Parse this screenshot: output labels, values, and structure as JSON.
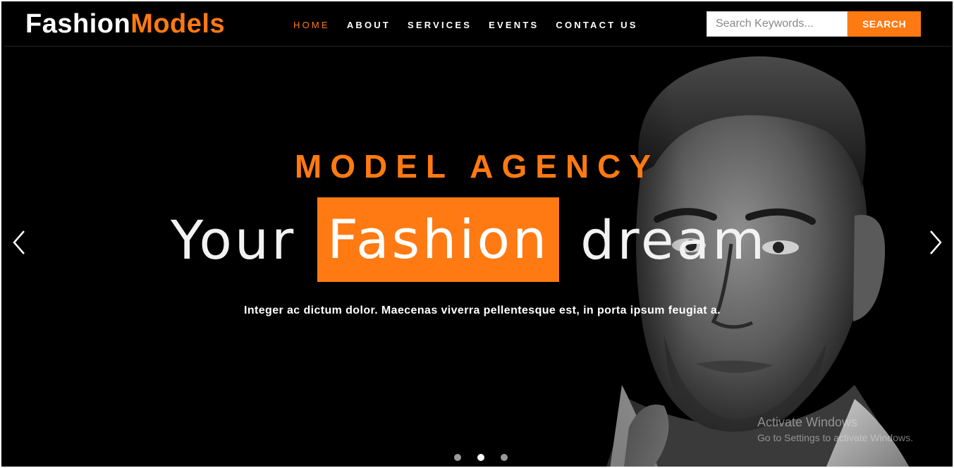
{
  "brand": {
    "part1": "Fashion",
    "part2": "Models"
  },
  "nav": {
    "items": [
      {
        "label": "HOME"
      },
      {
        "label": "ABOUT"
      },
      {
        "label": "SERVICES"
      },
      {
        "label": "EVENTS"
      },
      {
        "label": "CONTACT US"
      }
    ],
    "active_index": 0
  },
  "search": {
    "placeholder": "Search Keywords...",
    "value": "",
    "button_label": "SEARCH"
  },
  "hero": {
    "subtitle": "MODEL AGENCY",
    "title_before": "Your",
    "title_highlight": "Fashion",
    "title_after": "dream",
    "text": "Integer ac dictum dolor. Maecenas viverra pellentesque est, in porta ipsum feugiat a."
  },
  "carousel": {
    "slides": 3,
    "active_slide": 2,
    "prev_icon": "chevron-left-icon",
    "next_icon": "chevron-right-icon"
  },
  "system_watermark": {
    "line1": "Activate Windows",
    "line2": "Go to Settings to activate Windows."
  },
  "colors": {
    "accent": "#ff7a12",
    "background": "#000000",
    "text": "#ffffff"
  }
}
